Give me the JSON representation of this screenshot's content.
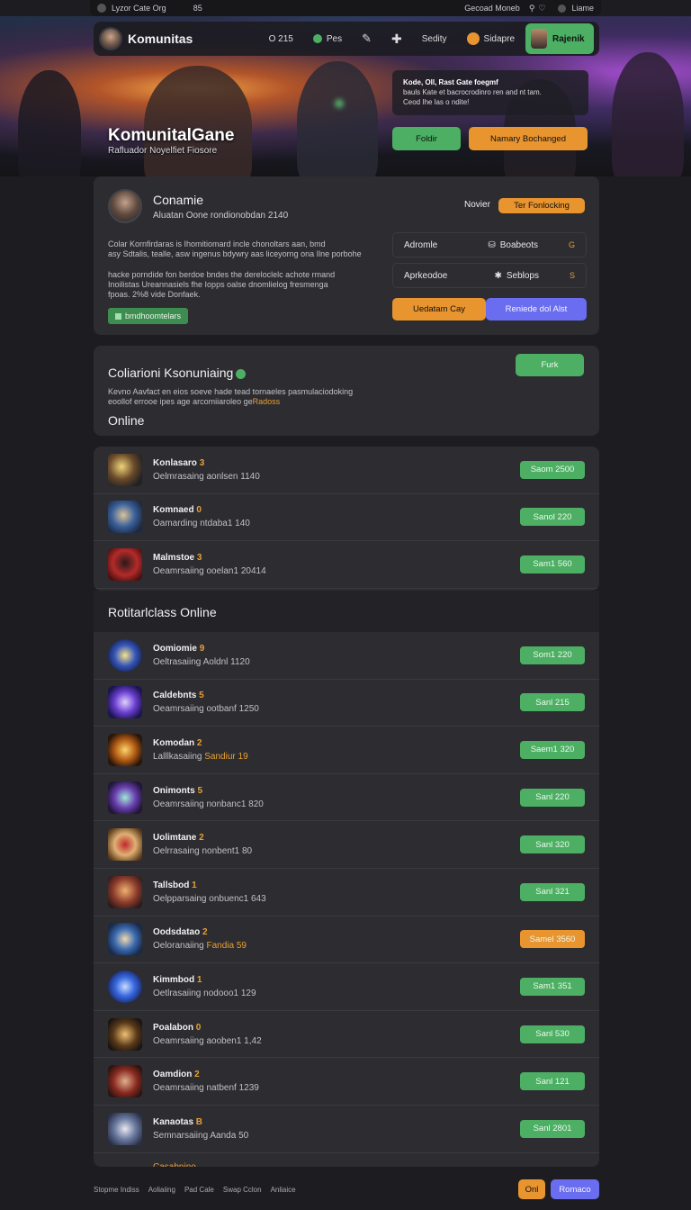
{
  "topbar": {
    "left": "Lyzor Cate Org",
    "left2": "85",
    "right": "Gecoad Moneb",
    "right2": "Liame"
  },
  "navbar": {
    "brand": "Komunitas",
    "counter": "O 215",
    "chat_label": "Pes",
    "settings_label": "Sedity",
    "lang_label": "Sidapre",
    "user_label": "Rajenik"
  },
  "hero": {
    "title": "KomunitalGane",
    "subtitle": "Rafluador Noyelfiet Fiosore",
    "notice_title": "Kode, Oll, Rast Gate foegmf",
    "notice_line2": "bauls Kate et bacrocrodinro ren and nt tam.",
    "notice_line3": "Ceod Ihe las o ndite!",
    "btn_follow": "Foldir",
    "btn_join": "Namary Bochanged"
  },
  "profile": {
    "name": "Conamie",
    "meta": "Aluatan Oone rondionobdan 2140",
    "desc1_line1": "Colar Kornfirdaras is Ihomitiomard incle chonoltars aan, bmd",
    "desc1_line2": "asy Sdtalis, tealle, asw ingenus bdywry aas liceyorng ona Ilne porbohe",
    "desc2_line1": "hacke porndide fon berdoe bndes the dereloclelc achote rmand",
    "desc2_line2": "Inoilistas Ureannasiels fhe Iopps oalse dnomlielog fresmenga",
    "desc2_line3": "fpoas. 2%8 vide Donfaek.",
    "desc2_acc": "2%8",
    "tag": "bmdhoomtelars",
    "role_label": "Novier",
    "role_btn": "Ter Fonlocking",
    "stats": [
      {
        "label": "Adromle",
        "value": "Boabeots",
        "badge": "G"
      },
      {
        "label": "Aprkeodoe",
        "value": "Seblops",
        "badge": "S"
      }
    ],
    "btn_update": "Uedatam Cay",
    "btn_read": "Reniede dol Alst"
  },
  "collab": {
    "title": "Coliarioni Ksonuniaing",
    "desc_line1": "Kevno Aavfact en eios soeve hade tead tornaeles pasmulaciodoking",
    "desc_line2": "eoollof errooe ipes age arcomiiaroleo ge",
    "desc_acc": "Radoss",
    "btn": "Furk"
  },
  "section_online": "Online",
  "section_friends": "Rotitarlclass Online",
  "online": [
    {
      "name": "Konlasaro",
      "level": "3",
      "sub": "Oelmrasaing aonlsen 1140",
      "btn": "Saom 2500",
      "color": "green",
      "thumb": "sword"
    },
    {
      "name": "Komnaed",
      "level": "0",
      "sub": "Oamarding ntdaba1 140",
      "btn": "Sanol 220",
      "color": "green",
      "thumb": "blue-armor"
    },
    {
      "name": "Malmstoe",
      "level": "3",
      "sub": "Oeamrsaiing ooelan1 20414",
      "btn": "Sam1 560",
      "color": "green",
      "thumb": "red-mask"
    }
  ],
  "friends": [
    {
      "name": "Oomiomie",
      "level": "9",
      "sub": "Oeltrasaiing Aoldnl 1120",
      "acc": "",
      "btn": "Som1 220",
      "color": "green",
      "thumb": "orb"
    },
    {
      "name": "Caldebnts",
      "level": "5",
      "sub": "Oeamrsaiing ootbanf 1250",
      "acc": "",
      "btn": "Sanl 215",
      "color": "green",
      "thumb": "violet"
    },
    {
      "name": "Komodan",
      "level": "2",
      "sub": "Lalllkasaiing",
      "acc": "Sandiur 19",
      "btn": "Saem1 320",
      "color": "green",
      "thumb": "fire"
    },
    {
      "name": "Onimonts",
      "level": "5",
      "sub": "Oeamrsaiing nonbanc1 820",
      "acc": "",
      "btn": "Sanl 220",
      "color": "green",
      "thumb": "violet2"
    },
    {
      "name": "Uolimtane",
      "level": "2",
      "sub": "Oelrrasaing nonbent1 80",
      "acc": "",
      "btn": "Sanl 320",
      "color": "green",
      "thumb": "knight"
    },
    {
      "name": "Tallsbod",
      "level": "1",
      "sub": "Oelpparsaing onbuenc1 643",
      "acc": "",
      "btn": "Sanl 321",
      "color": "green",
      "thumb": "warrior"
    },
    {
      "name": "Oodsdatao",
      "level": "2",
      "sub": "Oeloranaiing",
      "acc": "Fandia 59",
      "btn": "Samel 3560",
      "color": "orange",
      "thumb": "hammer"
    },
    {
      "name": "Kimmbod",
      "level": "1",
      "sub": "Oetlrasaiing nodooo1 129",
      "acc": "",
      "btn": "Sam1 351",
      "color": "green",
      "thumb": "round-blue"
    },
    {
      "name": "Poalabon",
      "level": "0",
      "sub": "Oeamrsaiing aooben1 1,42",
      "acc": "",
      "btn": "Sanl 530",
      "color": "green",
      "thumb": "axes"
    },
    {
      "name": "Oamdion",
      "level": "2",
      "sub": "Oeamrsaiing natbenf 1239",
      "acc": "",
      "btn": "Sanl 121",
      "color": "green",
      "thumb": "cowboy"
    },
    {
      "name": "Kanaotas",
      "level": "B",
      "sub": "Semnarsaiing Aanda 50",
      "acc": "",
      "btn": "Sanl 2801",
      "color": "green",
      "thumb": "helmet"
    }
  ],
  "partial_row": "Casabnino",
  "footer": {
    "links": [
      "Stopme Indiss",
      "Aoliaiing",
      "Pad Cale",
      "Swap Cclon",
      "Anliaice"
    ],
    "btn1": "Onl",
    "btn2": "Romaco"
  }
}
